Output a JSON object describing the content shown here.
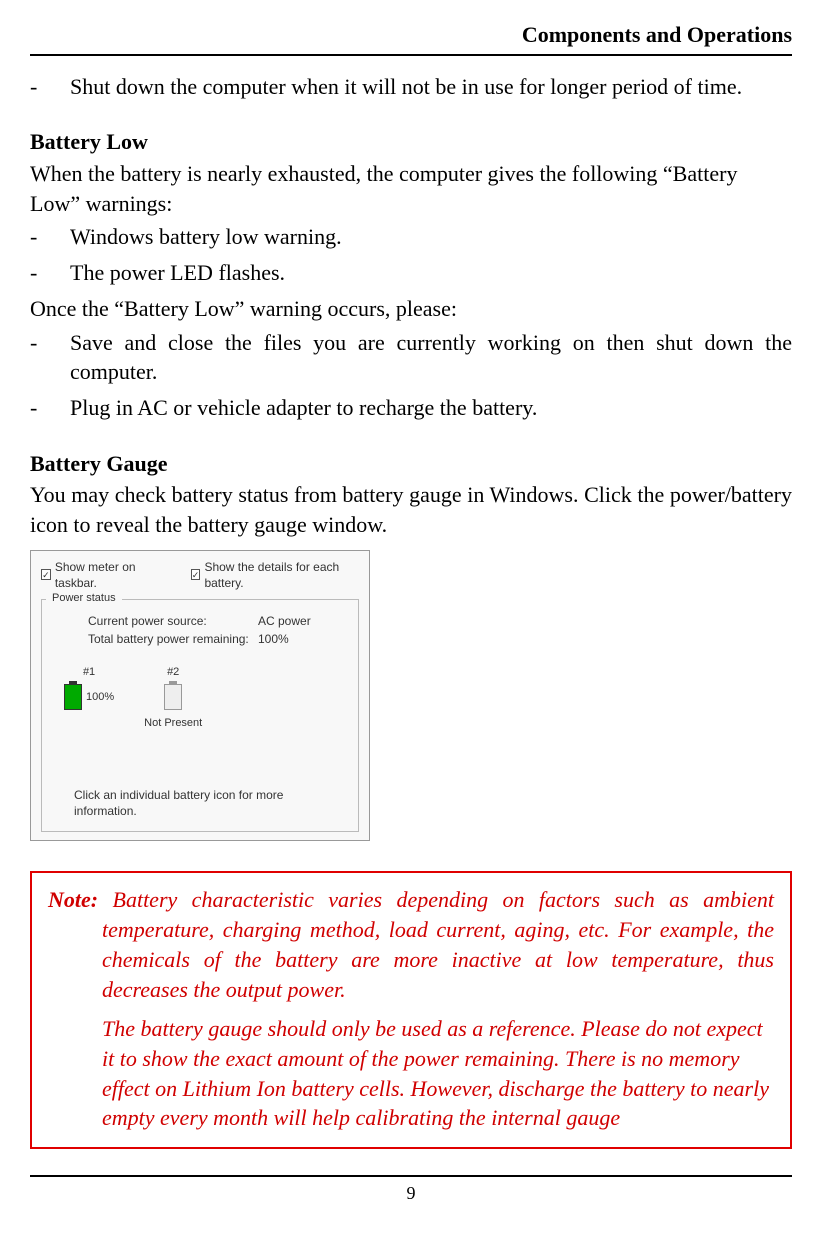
{
  "header": "Components and Operations",
  "top_bullets": [
    "Shut down the computer when it will not be in use for longer period of time."
  ],
  "sections": {
    "battery_low": {
      "heading": "Battery Low",
      "intro": "When the battery is nearly exhausted, the computer gives the following “Battery Low” warnings:",
      "bullets1": [
        "Windows battery low warning.",
        "The power LED flashes."
      ],
      "mid": "Once the “Battery Low” warning occurs, please:",
      "bullets2": [
        "Save and close the files you are currently working on then shut down the computer.",
        "Plug in AC or vehicle adapter to recharge the battery."
      ]
    },
    "battery_gauge": {
      "heading": "Battery Gauge",
      "intro": "You may check battery status from battery gauge in Windows. Click the power/battery icon to reveal the battery gauge window."
    }
  },
  "dialog": {
    "chk1": "Show meter on taskbar.",
    "chk2": "Show the details for each battery.",
    "group_label": "Power status",
    "row1_label": "Current power source:",
    "row1_value": "AC power",
    "row2_label": "Total battery power remaining:",
    "row2_value": "100%",
    "batt1_id": "#1",
    "batt1_pct": "100%",
    "batt2_id": "#2",
    "batt2_status": "Not Present",
    "hint": "Click an individual battery icon for more information."
  },
  "note": {
    "label": "Note:",
    "p1": "Battery characteristic varies depending on factors such as ambient temperature, charging method, load current, aging, etc. For example, the chemicals of the battery are more inactive at low temperature, thus decreases the output power.",
    "p2": "The battery gauge should only be used as a reference. Please do not expect it to show the exact amount of the power remaining. There is no memory effect on Lithium Ion battery cells. However, discharge the battery to nearly empty every month will help calibrating the internal gauge"
  },
  "page_number": "9"
}
